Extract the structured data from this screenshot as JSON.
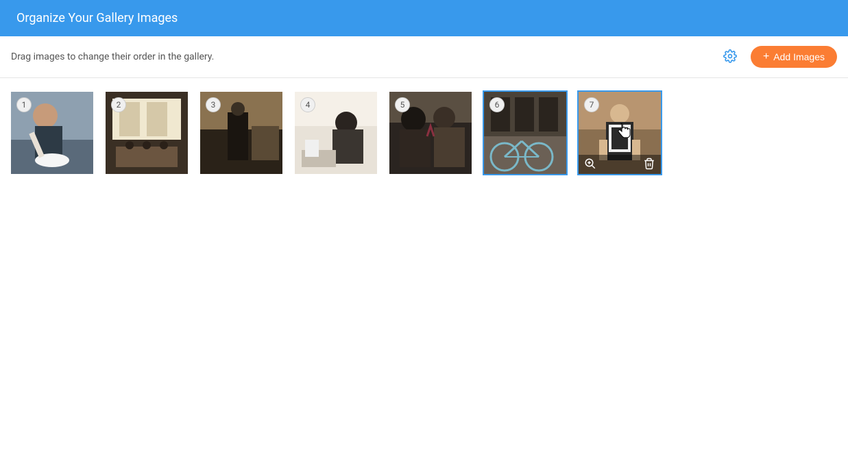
{
  "header": {
    "title": "Organize Your Gallery Images"
  },
  "subheader": {
    "instruction": "Drag images to change their order in the gallery.",
    "add_button_label": "Add Images"
  },
  "gallery": {
    "items": [
      {
        "order": "1",
        "alt": "barista-pouring-latte",
        "selected": false,
        "hovered": false
      },
      {
        "order": "2",
        "alt": "cafe-interior-tables",
        "selected": false,
        "hovered": false
      },
      {
        "order": "3",
        "alt": "person-ordering-counter",
        "selected": false,
        "hovered": false
      },
      {
        "order": "4",
        "alt": "woman-working-laptop",
        "selected": false,
        "hovered": false
      },
      {
        "order": "5",
        "alt": "friends-drinking-wine",
        "selected": false,
        "hovered": false
      },
      {
        "order": "6",
        "alt": "bicycle-storefront",
        "selected": true,
        "hovered": false
      },
      {
        "order": "7",
        "alt": "barista-arms-crossed",
        "selected": true,
        "hovered": true
      }
    ]
  },
  "colors": {
    "primary": "#3899ec",
    "accent": "#fb7d33"
  }
}
